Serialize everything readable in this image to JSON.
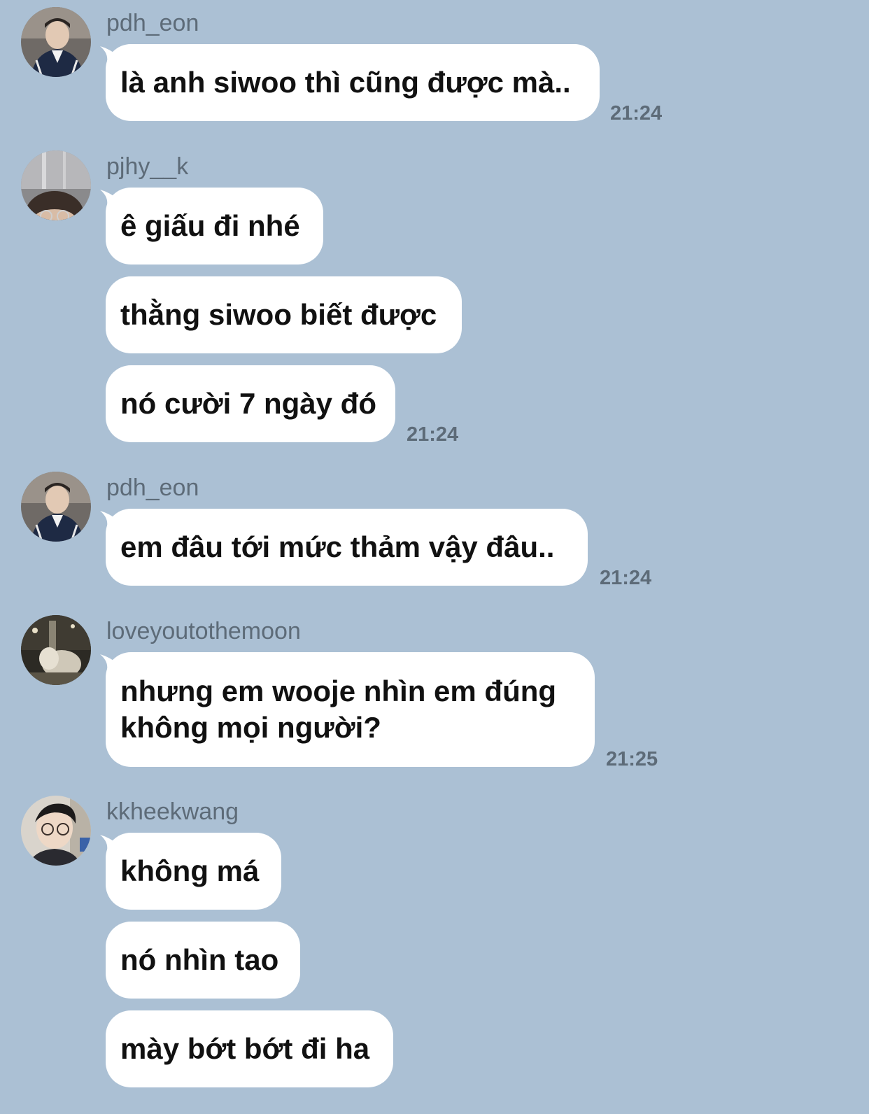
{
  "messages": [
    {
      "sender": "pdh_eon",
      "avatar": "avatar-pdh-eon",
      "bubbles": [
        "là anh siwoo thì cũng được mà.."
      ],
      "time": "21:24"
    },
    {
      "sender": "pjhy__k",
      "avatar": "avatar-pjhy-k",
      "bubbles": [
        "ê giấu đi nhé",
        "thằng siwoo biết được",
        "nó cười 7 ngày đó"
      ],
      "time": "21:24"
    },
    {
      "sender": "pdh_eon",
      "avatar": "avatar-pdh-eon",
      "bubbles": [
        "em đâu tới mức thảm vậy đâu.."
      ],
      "time": "21:24"
    },
    {
      "sender": "loveyoutothemoon",
      "avatar": "avatar-loveyoutothemoon",
      "bubbles": [
        "nhưng em wooje nhìn em đúng không mọi người?"
      ],
      "time": "21:25"
    },
    {
      "sender": "kkheekwang",
      "avatar": "avatar-kkheekwang",
      "bubbles": [
        "không má",
        "nó nhìn tao",
        "mày bớt bớt đi ha"
      ]
    }
  ],
  "colors": {
    "background": "#abc0d4",
    "bubble": "#ffffff",
    "meta_text": "#5d6b78",
    "message_text": "#111111"
  }
}
